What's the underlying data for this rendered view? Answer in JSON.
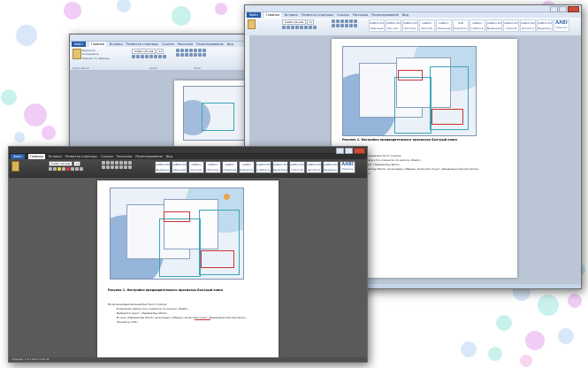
{
  "colors": {
    "background": "#ffffff",
    "word_blue": "#2a5da8",
    "dark_window": "#3b3b3b",
    "document_page": "#ffffff",
    "accent_teal": "#3aa6b8",
    "accent_red": "#c33333",
    "bokeh": [
      "#e7a6f0",
      "#b9d6f3",
      "#9fe9df",
      "#f2b6e6"
    ]
  },
  "win_back_right": {
    "tabs": [
      "Файл",
      "Главная",
      "Вставка",
      "Разметка страницы",
      "Ссылки",
      "Рассылки",
      "Рецензирование",
      "Вид"
    ],
    "font_name": "Calibri (Основ",
    "font_size": "11",
    "styles": [
      "AaBbCcDd",
      "AaBbCcDd",
      "AaBbCcDd",
      "AaBbCc",
      "AaBbCc",
      "AaB",
      "AaBbCc",
      "AaBbCcDd",
      "AaBbCcDd",
      "AaBbCcDd",
      "AaBbCcDd",
      "AaBbCcDd",
      "AaBbCcDd",
      "AaBbCcDd",
      "AABI"
    ],
    "style_names": [
      "Обычный",
      "Без инт.",
      "Заголов.",
      "Заголов.",
      "Название",
      "Подзагол.",
      "Слабое в.",
      "Выделение",
      "Строгий",
      "Цитата 2",
      "Выделен.",
      "Слабая с.",
      "Сильная с.",
      "Название",
      "Изменить"
    ],
    "figure_caption": "Рисунок 1. Настройка предварительного просмотра Быстрый поиск",
    "list": [
      "Включение/выключение быстрого поиска:",
      "В верхнем левом углу кликните по кнопке «Файл».",
      "Выберите пункт «Параметры Word».",
      "В окне «Параметры Word» на вкладке «Общие» включите пункт «Динамический просмотр».",
      "Нажмите «ОК»."
    ],
    "status": "Страница: 1 из 1   Число слов: 39"
  },
  "win_back_left": {
    "tabs": [
      "Файл",
      "Главная",
      "Вставка",
      "Разметка страницы",
      "Ссылки",
      "Рассылки",
      "Рецензирование",
      "Вид"
    ],
    "font_name": "Calibri (Основ",
    "font_size": "11",
    "clipboard": [
      "Вырезать",
      "Копировать",
      "Формат по образцу"
    ],
    "group_labels": [
      "Буфер обмена",
      "Шрифт",
      "Абзац"
    ]
  },
  "win_front_dark": {
    "tabs": [
      "Файл",
      "Главная",
      "Вставка",
      "Разметка страницы",
      "Ссылки",
      "Рассылки",
      "Рецензирование",
      "Вид"
    ],
    "font_name": "Calibri (Основ",
    "font_size": "11",
    "styles": [
      "AaBbCcDd",
      "AaBbCcDd",
      "AaBbCc",
      "AaBbCc",
      "AaBbCc",
      "AaBbC",
      "AaBbCcDd",
      "AaBbCcDd",
      "AaBbCcDd",
      "AaBbCcDd",
      "AaBbCcDd",
      "AaBbCcDd",
      "AABI"
    ],
    "style_names": [
      "Выделен.",
      "Обычный",
      "Заголов.",
      "Заголов.",
      "Название",
      "Подзагол.",
      "Слабое в.",
      "Выделение",
      "Строгий",
      "Цитата 2",
      "Выделен.",
      "Слабая с.",
      "Изменить"
    ],
    "figure_caption": "Рисунок 1. Настройка предварительного просмотра Быстрый поиск",
    "list_intro": "Включение/выключение быстрого поиска:",
    "list": [
      "В верхнем левом углу кликните по кнопке «Файл».",
      "Выберите пункт «Параметры Word».",
      "В окне «Параметры Word» на вкладке «Общие» включите пункт «Динамический просмотр».",
      "Нажмите «ОК»."
    ],
    "status": "Страница: 1 из 1   Число слов: 39"
  }
}
